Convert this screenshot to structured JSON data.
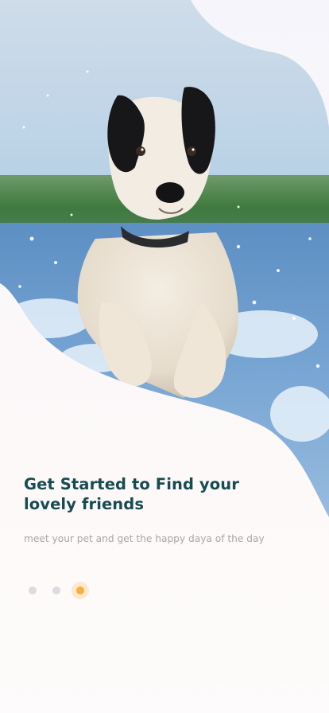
{
  "onboarding": {
    "headline": "Get Started to Find your lovely friends",
    "subtitle": "meet your pet and get the happy daya of the day",
    "pager": {
      "total": 3,
      "active_index": 3,
      "active_color": "#f7b03e",
      "inactive_color": "#dcdbe0"
    }
  },
  "hero_image": {
    "subject": "black-and-white-dog-running-through-water-photo"
  },
  "colors": {
    "headline": "#174b52",
    "subtitle": "#a7a7ab",
    "background": "#fbf8fa"
  }
}
